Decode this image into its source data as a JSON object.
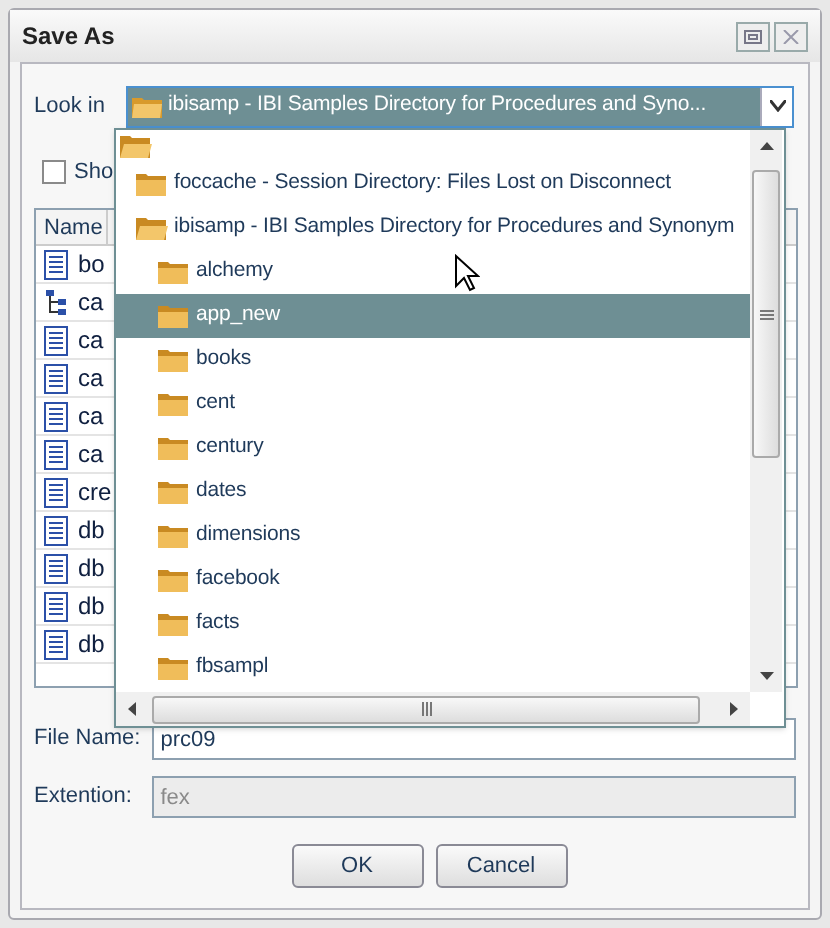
{
  "window": {
    "title": "Save As"
  },
  "look_in": {
    "label": "Look in",
    "value": "ibisamp - IBI Samples Directory for Procedures and Syno..."
  },
  "dropdown": {
    "items": [
      {
        "selected": false,
        "children": [
          {
            "label": "foccache - Session Directory: Files Lost on Disconnect",
            "selected": false
          },
          {
            "label": "ibisamp - IBI Samples Directory for Procedures and Synonym",
            "selected": false,
            "children": [
              {
                "label": "alchemy",
                "selected": false
              },
              {
                "label": "app_new",
                "selected": true
              },
              {
                "label": "books",
                "selected": false
              },
              {
                "label": "cent",
                "selected": false
              },
              {
                "label": "century",
                "selected": false
              },
              {
                "label": "dates",
                "selected": false
              },
              {
                "label": "dimensions",
                "selected": false
              },
              {
                "label": "facebook",
                "selected": false
              },
              {
                "label": "facts",
                "selected": false
              },
              {
                "label": "fbsampl",
                "selected": false
              }
            ]
          }
        ]
      }
    ]
  },
  "show_checkbox": {
    "label": "Sho",
    "checked": false
  },
  "file_list": {
    "columns": [
      "Name"
    ],
    "rows": [
      {
        "name": "bo",
        "kind": "document"
      },
      {
        "name": "ca",
        "kind": "tree"
      },
      {
        "name": "ca",
        "kind": "document"
      },
      {
        "name": "ca",
        "kind": "document"
      },
      {
        "name": "ca",
        "kind": "document"
      },
      {
        "name": "ca",
        "kind": "document"
      },
      {
        "name": "cre",
        "kind": "document"
      },
      {
        "name": "db",
        "kind": "document"
      },
      {
        "name": "db",
        "kind": "document"
      },
      {
        "name": "db",
        "kind": "document"
      },
      {
        "name": "db",
        "kind": "document"
      }
    ]
  },
  "file_name": {
    "label": "File Name:",
    "value": "prc09"
  },
  "extension": {
    "label": "Extention:",
    "value": "fex",
    "disabled": true
  },
  "buttons": [
    "OK",
    "Cancel"
  ]
}
